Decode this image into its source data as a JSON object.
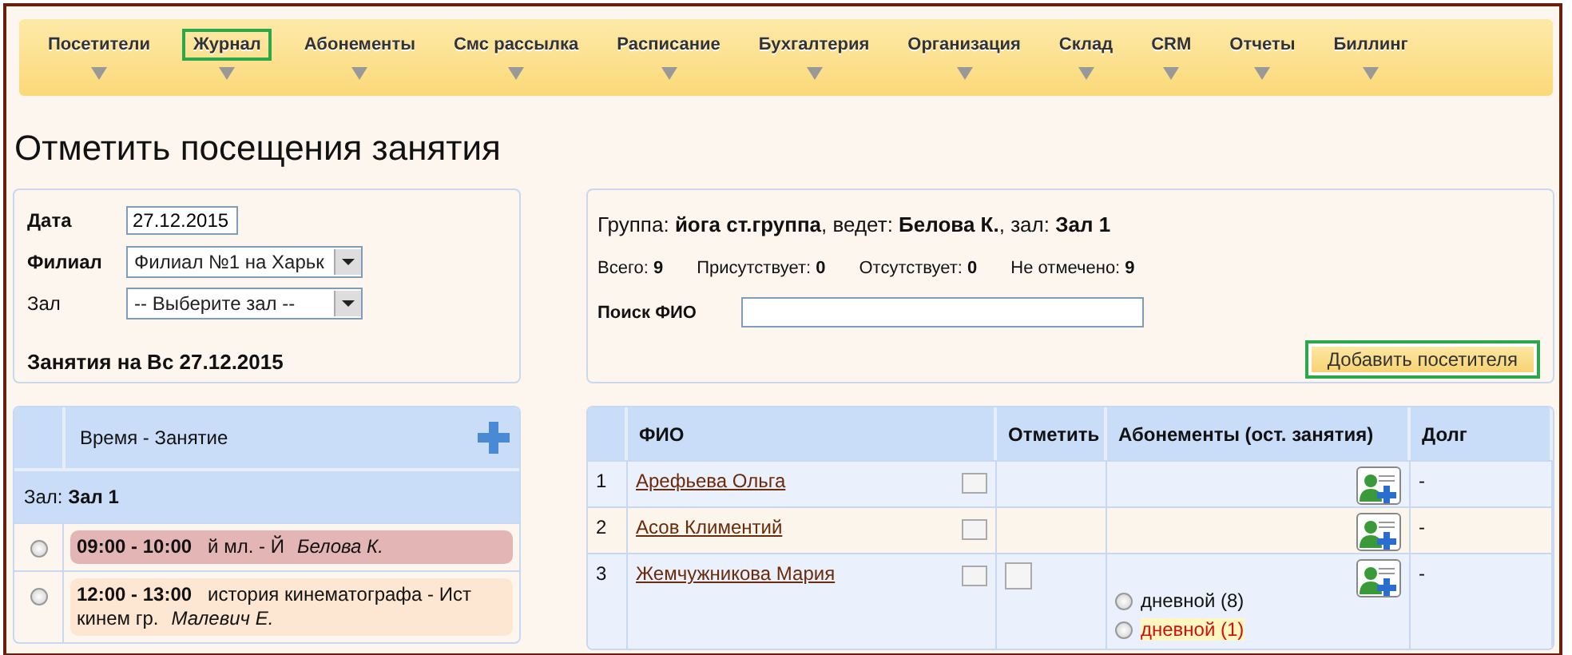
{
  "nav": [
    {
      "label": "Посетители",
      "selected": false
    },
    {
      "label": "Журнал",
      "selected": true
    },
    {
      "label": "Абонементы",
      "selected": false
    },
    {
      "label": "Смс рассылка",
      "selected": false
    },
    {
      "label": "Расписание",
      "selected": false
    },
    {
      "label": "Бухгалтерия",
      "selected": false
    },
    {
      "label": "Организация",
      "selected": false
    },
    {
      "label": "Склад",
      "selected": false
    },
    {
      "label": "CRM",
      "selected": false
    },
    {
      "label": "Отчеты",
      "selected": false
    },
    {
      "label": "Биллинг",
      "selected": false
    }
  ],
  "page_title": "Отметить посещения занятия",
  "filters": {
    "date_label": "Дата",
    "date_value": "27.12.2015",
    "branch_label": "Филиал",
    "branch_value": "Филиал №1 на Харьк",
    "hall_label": "Зал",
    "hall_value": "-- Выберите зал --",
    "day_heading": "Занятия на Вс 27.12.2015"
  },
  "sessions": {
    "header": "Время - Занятие",
    "group_label": "Зал: **Зал 1**",
    "items": [
      {
        "time": "09:00 - 10:00",
        "name": "й мл. - Й",
        "teacher": "Белова К.",
        "color": "#e4b5b5",
        "selected": false
      },
      {
        "time": "12:00 - 13:00",
        "name": "история кинематографа - Ист кинем гр.",
        "teacher": "Малевич Е.",
        "color": "#fde6d2",
        "selected": false
      }
    ]
  },
  "group_info": {
    "summary": "Группа: **йога ст.группа**, ведет: **Белова К.**, зал: **Зал 1**",
    "counts": [
      "Всего: **9**",
      "Присутствует: **0**",
      "Отсутствует: **0**",
      "Не отмечено: **9**"
    ],
    "search_label": "Поиск ФИО",
    "add_button": {
      "label": "Добавить посетителя",
      "highlighted": true
    }
  },
  "table": {
    "columns": [
      "ФИО",
      "Отметить",
      "Абонементы (ост. занятия)",
      "Долг"
    ],
    "rows": [
      {
        "num": "1",
        "name": "Арефьева Ольга",
        "mark": null,
        "subscriptions": [],
        "debt": "-"
      },
      {
        "num": "2",
        "name": "Асов Климентий",
        "mark": null,
        "subscriptions": [],
        "debt": "-"
      },
      {
        "num": "3",
        "name": "Жемчужникова Мария",
        "mark": {
          "checked": false
        },
        "subscriptions": [
          {
            "label": "дневной (8)",
            "selected": false,
            "expiring": false
          },
          {
            "label": "дневной (1)",
            "selected": false,
            "expiring": true
          }
        ],
        "debt": "-"
      }
    ]
  }
}
